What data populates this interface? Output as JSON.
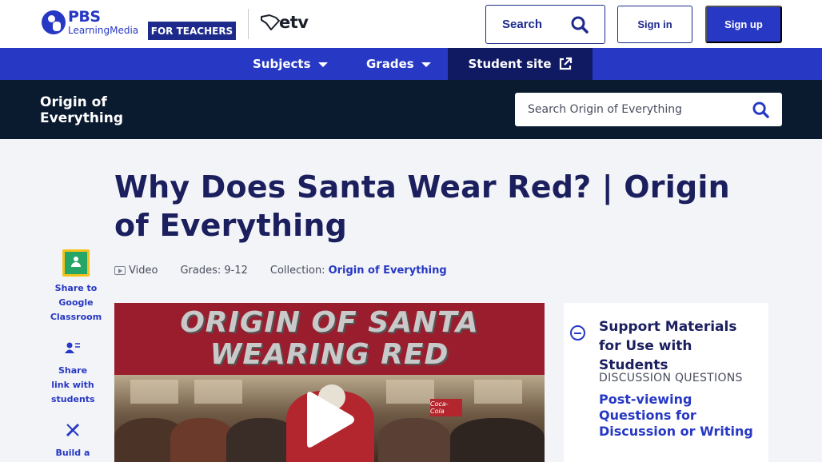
{
  "header": {
    "logo_pbs": "PBS",
    "logo_sub": "LearningMedia",
    "for_teachers": "FOR TEACHERS",
    "station": "etv",
    "search_label": "Search",
    "signin_label": "Sign in",
    "signup_label": "Sign up"
  },
  "nav": {
    "subjects": "Subjects",
    "grades": "Grades",
    "student_site": "Student site"
  },
  "collection": {
    "title_line1": "Origin of",
    "title_line2": "Everything",
    "search_placeholder": "Search Origin of Everything"
  },
  "page": {
    "title": "Why Does Santa Wear Red? | Origin of Everything",
    "media_type": "Video",
    "grades": "Grades: 9-12",
    "collection_label": "Collection:",
    "collection_link": "Origin of Everything"
  },
  "share": {
    "google_classroom": "Share to Google Classroom",
    "share_link": "Share link with students",
    "build": "Build a"
  },
  "video": {
    "banner_line1": "ORIGIN OF SANTA",
    "banner_line2": "WEARING RED",
    "sign_text": "Coca-Cola"
  },
  "support": {
    "heading": "Support Materials for Use with Students",
    "section_label": "DISCUSSION QUESTIONS",
    "link": "Post-viewing Questions for Discussion or Writing"
  },
  "colors": {
    "brand_blue": "#2638c4",
    "navy": "#1d2a8c",
    "collection_bar": "#0a1a2f"
  }
}
